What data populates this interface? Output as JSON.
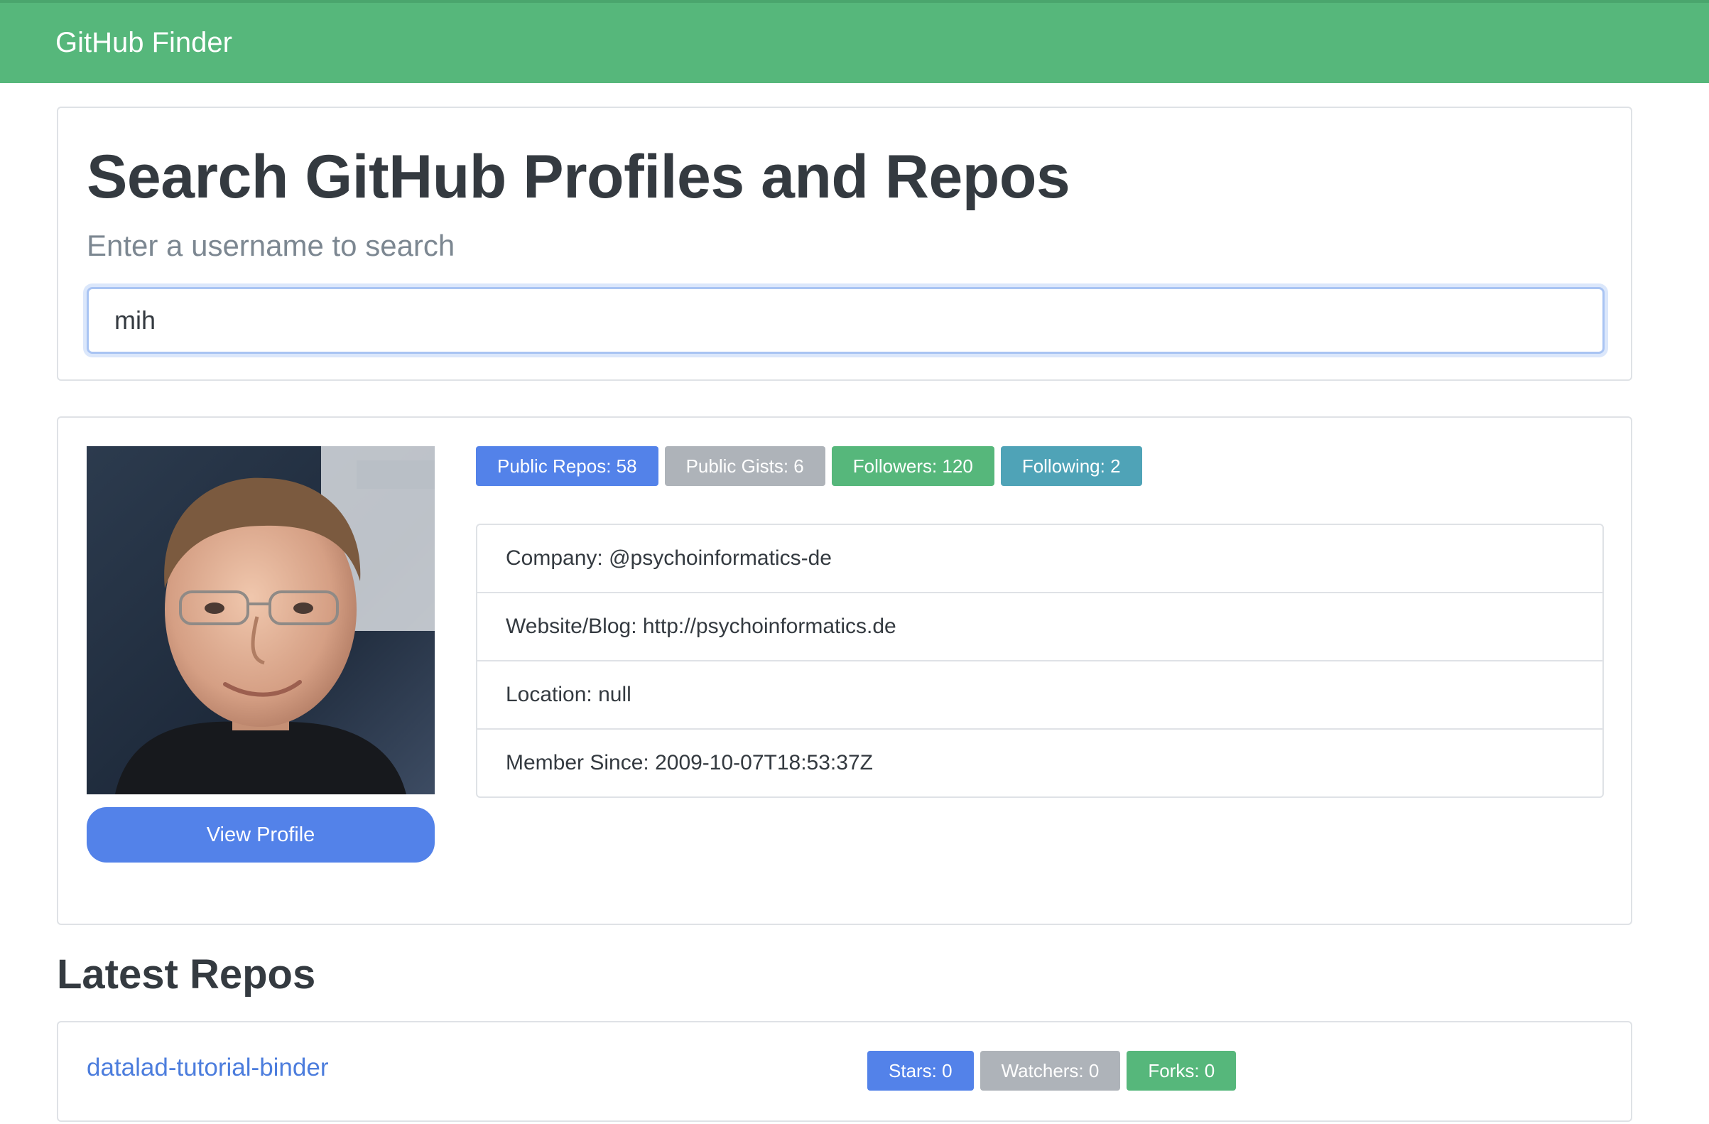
{
  "navbar": {
    "brand": "GitHub Finder",
    "color": "#56b77b"
  },
  "search": {
    "title": "Search GitHub Profiles and Repos",
    "lead": "Enter a username to search",
    "value": "mih"
  },
  "profile": {
    "avatar_icon": "user-avatar-photo",
    "view_profile_label": "View Profile",
    "badges": {
      "public_repos": "Public Repos: 58",
      "public_gists": "Public Gists: 6",
      "followers": "Followers: 120",
      "following": "Following: 2"
    },
    "details": {
      "company": "Company: @psychoinformatics-de",
      "website": "Website/Blog: http://psychoinformatics.de",
      "location": "Location: null",
      "member_since": "Member Since: 2009-10-07T18:53:37Z"
    }
  },
  "repos": {
    "title": "Latest Repos",
    "items": [
      {
        "name": "datalad-tutorial-binder",
        "stars": "Stars: 0",
        "watchers": "Watchers: 0",
        "forks": "Forks: 0"
      }
    ]
  },
  "colors": {
    "primary": "#5382e9",
    "secondary": "#aeb3b9",
    "success": "#56b77b",
    "info": "#4fa3b7"
  }
}
